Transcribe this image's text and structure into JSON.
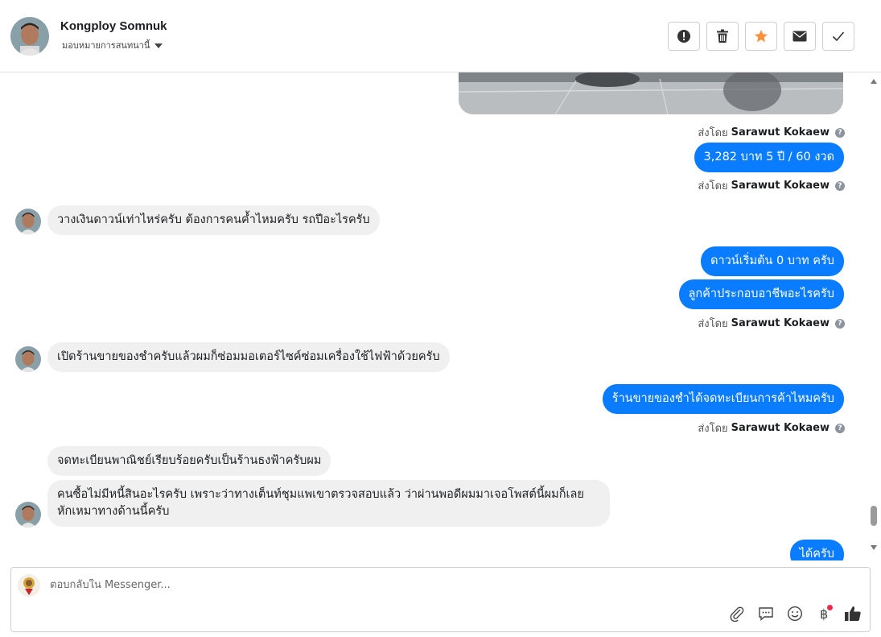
{
  "header": {
    "name": "Kongploy Somnuk",
    "subtitle": "มอบหมายการสนทนานี้"
  },
  "actions": [
    {
      "icon": "alert-icon",
      "color": "#444444"
    },
    {
      "icon": "trash-icon",
      "color": "#444444"
    },
    {
      "icon": "star-icon",
      "color": "#f7923a"
    },
    {
      "icon": "envelope-icon",
      "color": "#444444"
    },
    {
      "icon": "check-icon",
      "color": "#444444"
    }
  ],
  "messages": {
    "sent_by_prefix": "ส่งโดย",
    "agent_name": "Sarawut Kokaew",
    "out_1": "3,282 บาท 5 ปี / 60 งวด",
    "in_1": "วางเงินดาวน์เท่าไหร่ครับ ต้องการคนค้ำไหมครับ รถปีอะไรครับ",
    "out_2": "ดาวน์เริ่มต้น 0 บาท ครับ",
    "out_3": "ลูกค้าประกอบอาชีพอะไรครับ",
    "in_2": "เปิดร้านขายของชำครับแล้วผมก็ซ่อมมอเตอร์ไซค์ซ่อมเครื่องใช้ไฟฟ้าด้วยครับ",
    "out_4": "ร้านขายของชำได้จดทะเบียนการค้าไหมครับ",
    "in_3": "จดทะเบียนพาณิชย์เรียบร้อยครับเป็นร้านธงฟ้าครับผม",
    "in_4": "คนซื้อไม่มีหนี้สินอะไรครับ เพราะว่าทางเต็นท์ชุมแพเขาตรวจสอบแล้ว ว่าผ่านพอดีผมมาเจอโพสต์นี้ผมก็เลย หักเหมาทางด้านนี้ครับ",
    "out_5": "ได้ครับ"
  },
  "composer": {
    "placeholder": "ตอบกลับใน Messenger...",
    "tools": [
      "paperclip-icon",
      "chat-bubble-icon",
      "smiley-icon",
      "baht-icon",
      "thumbs-up-icon"
    ]
  },
  "colors": {
    "outgoing_bubble": "#0a7cff",
    "incoming_bubble": "#f0f0f0",
    "notification_dot": "#f02849"
  }
}
